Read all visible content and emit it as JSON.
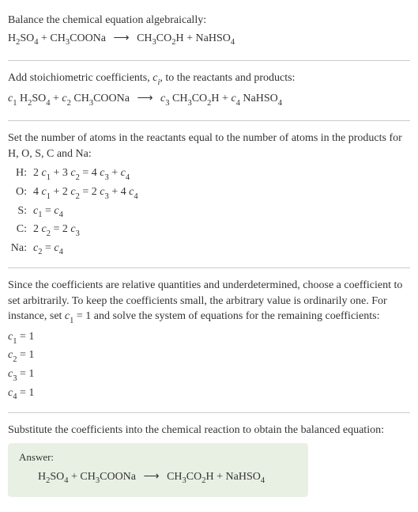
{
  "section1": {
    "intro": "Balance the chemical equation algebraically:",
    "eq_lhs1": "H",
    "eq_lhs1_sub": "2",
    "eq_lhs2": "SO",
    "eq_lhs2_sub": "4",
    "eq_plus1": " + CH",
    "eq_lhs3_sub": "3",
    "eq_lhs4": "COONa ",
    "eq_arrow": "⟶",
    "eq_rhs1": " CH",
    "eq_rhs1_sub": "3",
    "eq_rhs2": "CO",
    "eq_rhs2_sub": "2",
    "eq_rhs3": "H + NaHSO",
    "eq_rhs3_sub": "4"
  },
  "section2": {
    "intro_a": "Add stoichiometric coefficients, ",
    "intro_ci": "c",
    "intro_ci_sub": "i",
    "intro_b": ", to the reactants and products:",
    "c1": "c",
    "c1_sub": "1",
    "sp1": " H",
    "sp1_sub": "2",
    "sp2": "SO",
    "sp2_sub": "4",
    "plus1": " + ",
    "c2": "c",
    "c2_sub": "2",
    "sp3": " CH",
    "sp3_sub": "3",
    "sp4": "COONa ",
    "arrow": "⟶",
    "sp5": " ",
    "c3": "c",
    "c3_sub": "3",
    "sp6": " CH",
    "sp6_sub": "3",
    "sp7": "CO",
    "sp7_sub": "2",
    "sp8": "H + ",
    "c4": "c",
    "c4_sub": "4",
    "sp9": " NaHSO",
    "sp9_sub": "4"
  },
  "section3": {
    "intro": "Set the number of atoms in the reactants equal to the number of atoms in the products for H, O, S, C and Na:",
    "rows": [
      {
        "label": "H:",
        "c1a": "2 ",
        "c1": "c",
        "c1s": "1",
        "p1": " + 3 ",
        "c2": "c",
        "c2s": "2",
        "eq": " = 4 ",
        "c3": "c",
        "c3s": "3",
        "p2": " + ",
        "c4": "c",
        "c4s": "4"
      },
      {
        "label": "O:",
        "c1a": "4 ",
        "c1": "c",
        "c1s": "1",
        "p1": " + 2 ",
        "c2": "c",
        "c2s": "2",
        "eq": " = 2 ",
        "c3": "c",
        "c3s": "3",
        "p2": " + 4 ",
        "c4": "c",
        "c4s": "4"
      },
      {
        "label": "S:",
        "c1a": "",
        "c1": "c",
        "c1s": "1",
        "p1": "",
        "c2": "",
        "c2s": "",
        "eq": " = ",
        "c3": "",
        "c3s": "",
        "p2": "",
        "c4": "c",
        "c4s": "4"
      },
      {
        "label": "C:",
        "c1a": "2 ",
        "c1": "c",
        "c1s": "2",
        "p1": "",
        "c2": "",
        "c2s": "",
        "eq": " = 2 ",
        "c3": "c",
        "c3s": "3",
        "p2": "",
        "c4": "",
        "c4s": ""
      },
      {
        "label": "Na:",
        "c1a": "",
        "c1": "c",
        "c1s": "2",
        "p1": "",
        "c2": "",
        "c2s": "",
        "eq": " = ",
        "c3": "",
        "c3s": "",
        "p2": "",
        "c4": "c",
        "c4s": "4"
      }
    ]
  },
  "section4": {
    "intro_a": "Since the coefficients are relative quantities and underdetermined, choose a coefficient to set arbitrarily. To keep the coefficients small, the arbitrary value is ordinarily one. For instance, set ",
    "c1": "c",
    "c1_sub": "1",
    "intro_b": " = 1 and solve the system of equations for the remaining coefficients:",
    "coeffs": [
      {
        "c": "c",
        "s": "1",
        "v": " = 1"
      },
      {
        "c": "c",
        "s": "2",
        "v": " = 1"
      },
      {
        "c": "c",
        "s": "3",
        "v": " = 1"
      },
      {
        "c": "c",
        "s": "4",
        "v": " = 1"
      }
    ]
  },
  "section5": {
    "intro": "Substitute the coefficients into the chemical reaction to obtain the balanced equation:",
    "answer_label": "Answer:",
    "eq_lhs1": "H",
    "eq_lhs1_sub": "2",
    "eq_lhs2": "SO",
    "eq_lhs2_sub": "4",
    "eq_plus1": " + CH",
    "eq_lhs3_sub": "3",
    "eq_lhs4": "COONa ",
    "eq_arrow": "⟶",
    "eq_rhs1": " CH",
    "eq_rhs1_sub": "3",
    "eq_rhs2": "CO",
    "eq_rhs2_sub": "2",
    "eq_rhs3": "H + NaHSO",
    "eq_rhs3_sub": "4"
  }
}
